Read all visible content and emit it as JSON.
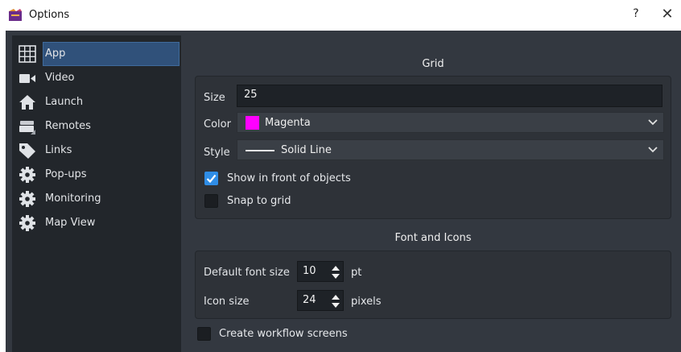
{
  "window": {
    "title": "Options",
    "help_label": "?",
    "close_label": "✕"
  },
  "sidebar": {
    "items": [
      {
        "label": "App",
        "icon": "grid-icon",
        "active": true
      },
      {
        "label": "Video",
        "icon": "video-camera-icon"
      },
      {
        "label": "Launch",
        "icon": "home-icon"
      },
      {
        "label": "Remotes",
        "icon": "remote-icon"
      },
      {
        "label": "Links",
        "icon": "tag-icon"
      },
      {
        "label": "Pop-ups",
        "icon": "gear-icon"
      },
      {
        "label": "Monitoring",
        "icon": "gear-icon"
      },
      {
        "label": "Map View",
        "icon": "gear-icon"
      }
    ]
  },
  "grid": {
    "title": "Grid",
    "size_label": "Size",
    "size_value": "25",
    "color_label": "Color",
    "color_value": "Magenta",
    "color_swatch": "#ff00ff",
    "style_label": "Style",
    "style_value": "Solid Line",
    "show_front_label": "Show in front of objects",
    "show_front_checked": true,
    "snap_label": "Snap to grid",
    "snap_checked": false
  },
  "font_icons": {
    "title": "Font and Icons",
    "font_size_label": "Default font size",
    "font_size_value": "10",
    "font_size_unit": "pt",
    "icon_size_label": "Icon size",
    "icon_size_value": "24",
    "icon_size_unit": "pixels"
  },
  "workflow": {
    "label": "Create workflow screens",
    "checked": false
  },
  "colors": {
    "accent": "#2f8de6",
    "selection": "#30517a",
    "background": "#333840",
    "sidebar": "#22262b"
  }
}
